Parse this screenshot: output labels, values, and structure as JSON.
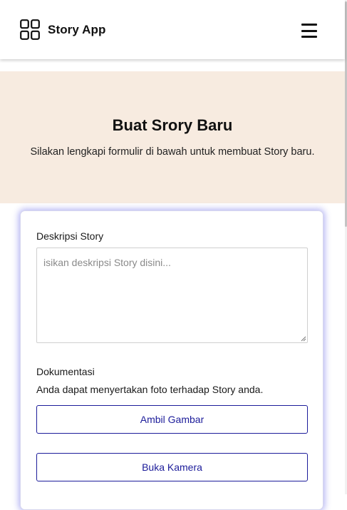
{
  "header": {
    "icon": "grid-icon",
    "title": "Story App",
    "menu_icon": "hamburger-menu-icon"
  },
  "hero": {
    "title": "Buat Srory Baru",
    "subtitle": "Silakan lengkapi formulir di bawah untuk membuat Story baru."
  },
  "form": {
    "description_label": "Deskripsi Story",
    "description_placeholder": "isikan deskripsi Story disini...",
    "description_value": "",
    "documentation_label": "Dokumentasi",
    "documentation_text": "Anda dapat menyertakan foto terhadap Story anda.",
    "take_picture_label": "Ambil Gambar",
    "open_camera_label": "Buka Kamera"
  },
  "colors": {
    "hero_background": "#f7ebe0",
    "accent": "#1c1c9a",
    "card_glow": "#5a5ae6"
  }
}
